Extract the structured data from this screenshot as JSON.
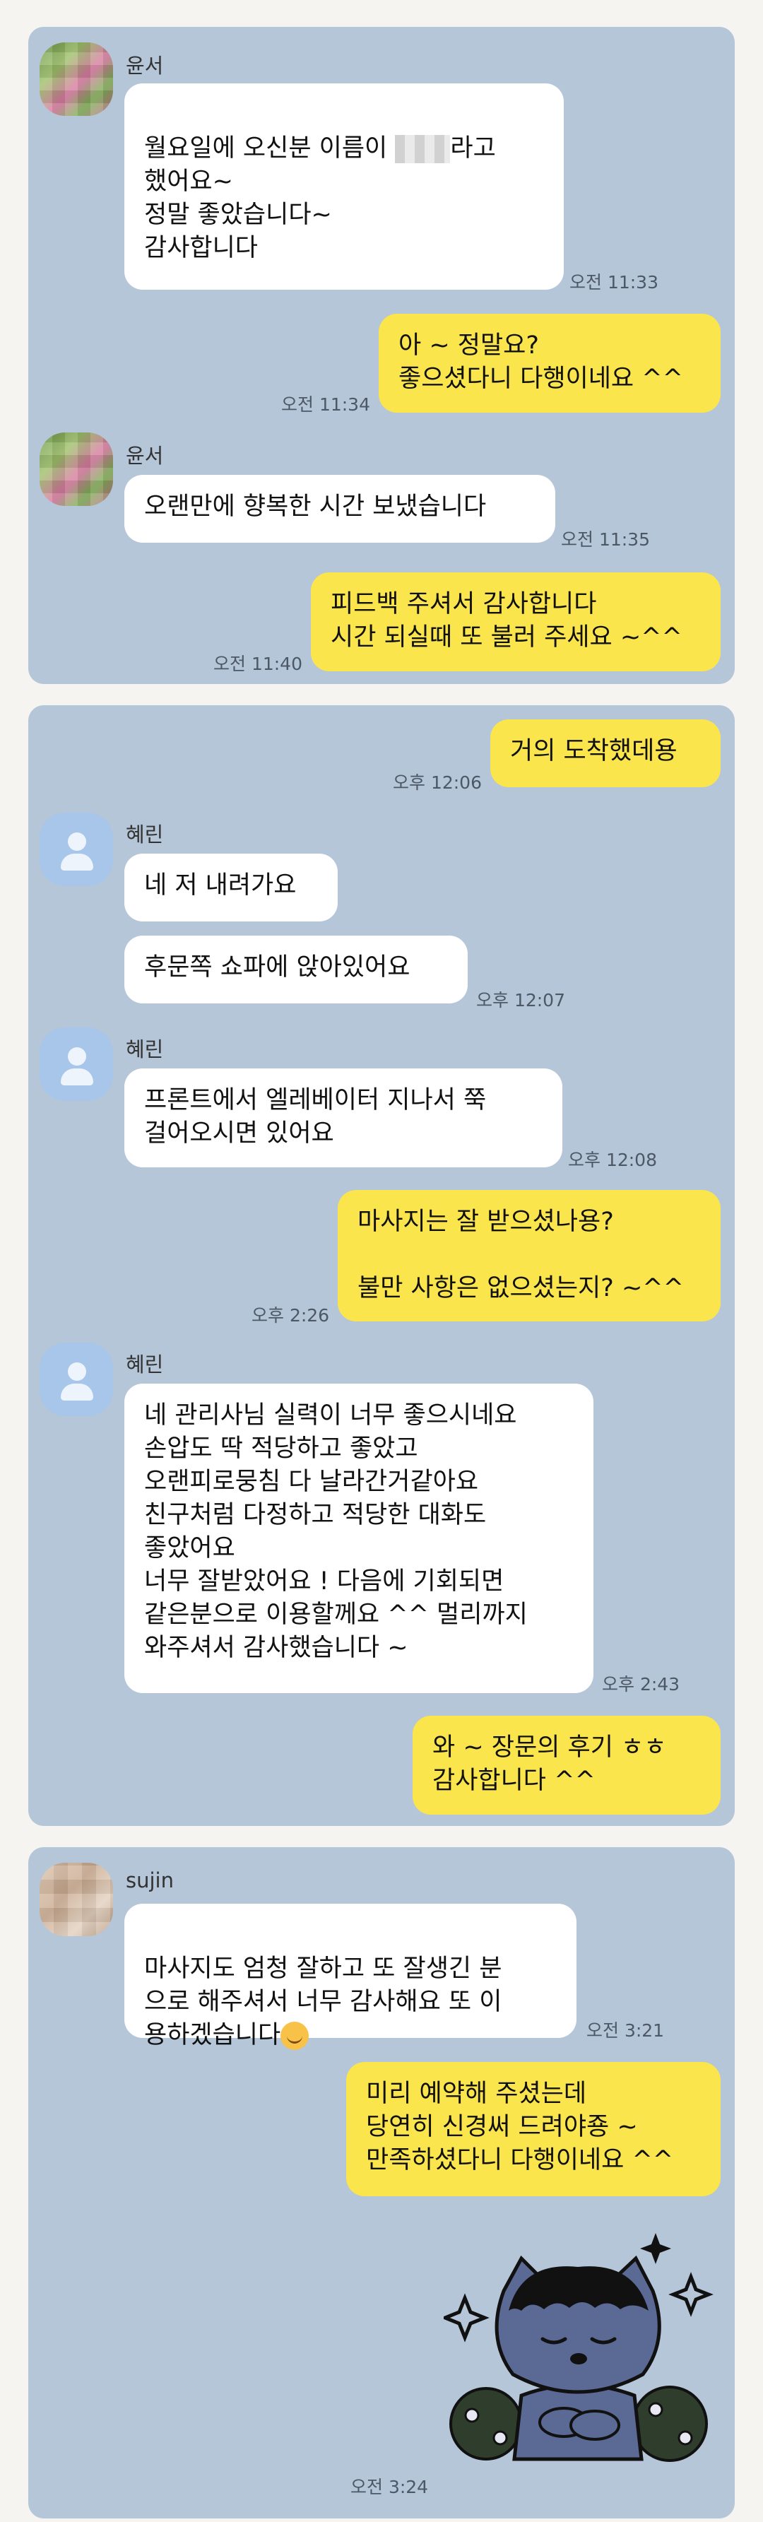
{
  "sections": [
    {
      "messages": [
        {
          "type": "in",
          "sender": "윤서",
          "text_before": "월요일에 오신분 이름이 ",
          "text_after": "라고\n했어요~\n정말 좋았습니다~\n감사합니다",
          "time": "오전 11:33"
        },
        {
          "type": "out",
          "text": "아 ~ 정말요?\n좋으셨다니 다행이네요 ^^",
          "time": "오전 11:34"
        },
        {
          "type": "in",
          "sender": "윤서",
          "text": "오랜만에 향복한 시간 보냈습니다",
          "time": "오전 11:35"
        },
        {
          "type": "out",
          "text": "피드백 주셔서 감사합니다\n시간 되실때 또 불러 주세요 ~^^",
          "time": "오전 11:40"
        }
      ]
    },
    {
      "messages": [
        {
          "type": "out",
          "text": "거의 도착했데용",
          "time": "오후 12:06"
        },
        {
          "type": "in",
          "sender": "혜린",
          "text": "네 저 내려가요"
        },
        {
          "type": "in",
          "text": "후문쪽 쇼파에 앉아있어요",
          "time": "오후 12:07"
        },
        {
          "type": "in",
          "sender": "혜린",
          "text": "프론트에서 엘레베이터 지나서 쭉\n걸어오시면 있어요",
          "time": "오후 12:08"
        },
        {
          "type": "out",
          "text": "마사지는 잘 받으셨나용?\n\n불만 사항은 없으셨는지? ~^^",
          "time": "오후 2:26"
        },
        {
          "type": "in",
          "sender": "혜린",
          "text": "네 관리사님 실력이 너무 좋으시네요\n손압도 딱 적당하고 좋았고\n오랜피로뭉침 다 날라간거같아요\n친구처럼 다정하고 적당한 대화도\n좋았어요\n너무 잘받았어요 ! 다음에 기회되면\n같은분으로 이용할께요 ^^ 멀리까지\n와주셔서 감사했습니다 ~",
          "time": "오후 2:43"
        },
        {
          "type": "out",
          "text": "와 ~ 장문의 후기 ㅎㅎ\n감사합니다 ^^"
        }
      ]
    },
    {
      "messages": [
        {
          "type": "in",
          "sender": "sujin",
          "text": "마사지도 엄청 잘하고 또 잘생긴 분\n으로 해주셔서 너무 감사해요 또 이\n용하겠습니다",
          "time": "오전 3:21"
        },
        {
          "type": "out",
          "text": "미리 예약해 주셨는데\n당연히 신경써 드려야죵 ~\n만족하셨다니 다행이네요 ^^"
        },
        {
          "type": "sticker",
          "icon": "cat-sticker-icon",
          "time": "오전 3:24"
        }
      ]
    }
  ],
  "colors": {
    "chat_background": "#b5c6d8",
    "incoming_bubble": "#ffffff",
    "outgoing_bubble": "#fbe54d",
    "page_background": "#f6f4f1"
  }
}
